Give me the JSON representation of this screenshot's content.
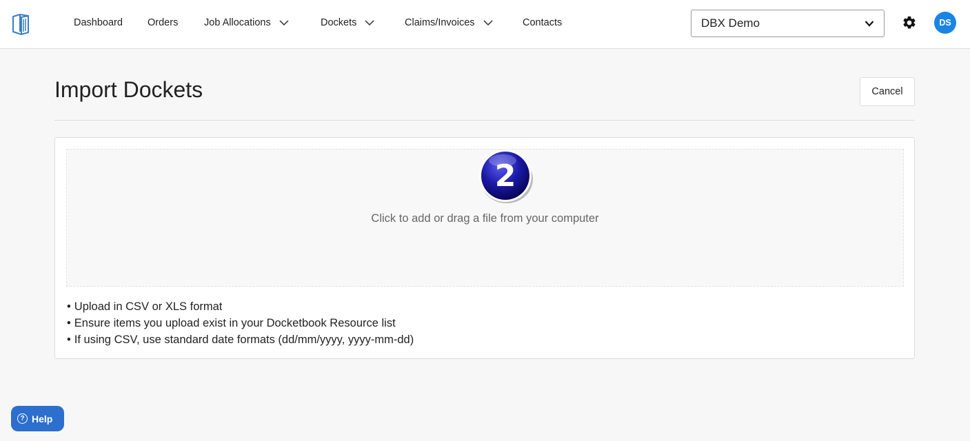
{
  "nav": {
    "items": [
      {
        "label": "Dashboard",
        "has_dropdown": false
      },
      {
        "label": "Orders",
        "has_dropdown": false
      },
      {
        "label": "Job Allocations",
        "has_dropdown": true
      },
      {
        "label": "Dockets",
        "has_dropdown": true
      },
      {
        "label": "Claims/Invoices",
        "has_dropdown": true
      },
      {
        "label": "Contacts",
        "has_dropdown": false
      }
    ],
    "org_selected": "DBX Demo",
    "avatar_initials": "DS"
  },
  "page": {
    "title": "Import Dockets",
    "cancel_label": "Cancel"
  },
  "upload": {
    "step_number": "2",
    "dropzone_text": "Click to add or drag a file from your computer",
    "notes": [
      "Upload in CSV or XLS format",
      "Ensure items you upload exist in your Docketbook Resource list",
      "If using CSV, use standard date formats (dd/mm/yyyy, yyyy-mm-dd)"
    ]
  },
  "help": {
    "label": "Help"
  },
  "colors": {
    "accent": "#1a84e5",
    "help_button": "#2c6fcd",
    "step_badge": "#1c1aa8"
  }
}
